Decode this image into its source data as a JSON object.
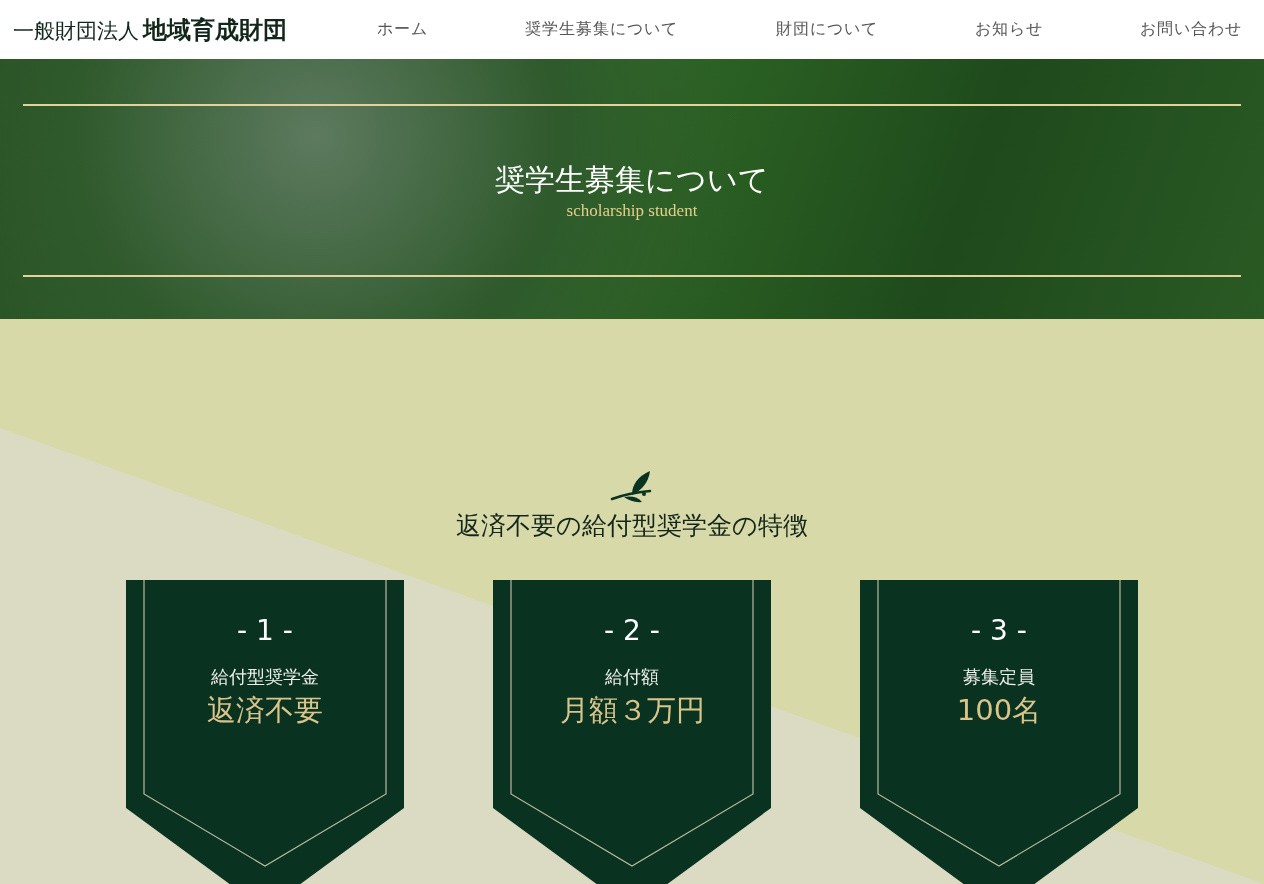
{
  "header": {
    "logo_prefix": "一般財団法人",
    "logo_name": "地域育成財団",
    "nav": [
      {
        "label": "ホーム"
      },
      {
        "label": "奨学生募集について"
      },
      {
        "label": "財団について"
      },
      {
        "label": "お知らせ"
      },
      {
        "label": "お問い合わせ"
      }
    ]
  },
  "hero": {
    "title": "奨学生募集について",
    "subtitle": "scholarship student"
  },
  "features": {
    "heading": "返済不要の給付型奨学金の特徴",
    "cards": [
      {
        "number": "- 1 -",
        "label": "給付型奨学金",
        "value": "返済不要"
      },
      {
        "number": "- 2 -",
        "label": "給付額",
        "value": "月額３万円"
      },
      {
        "number": "- 3 -",
        "label": "募集定員",
        "value": "100名"
      }
    ]
  }
}
